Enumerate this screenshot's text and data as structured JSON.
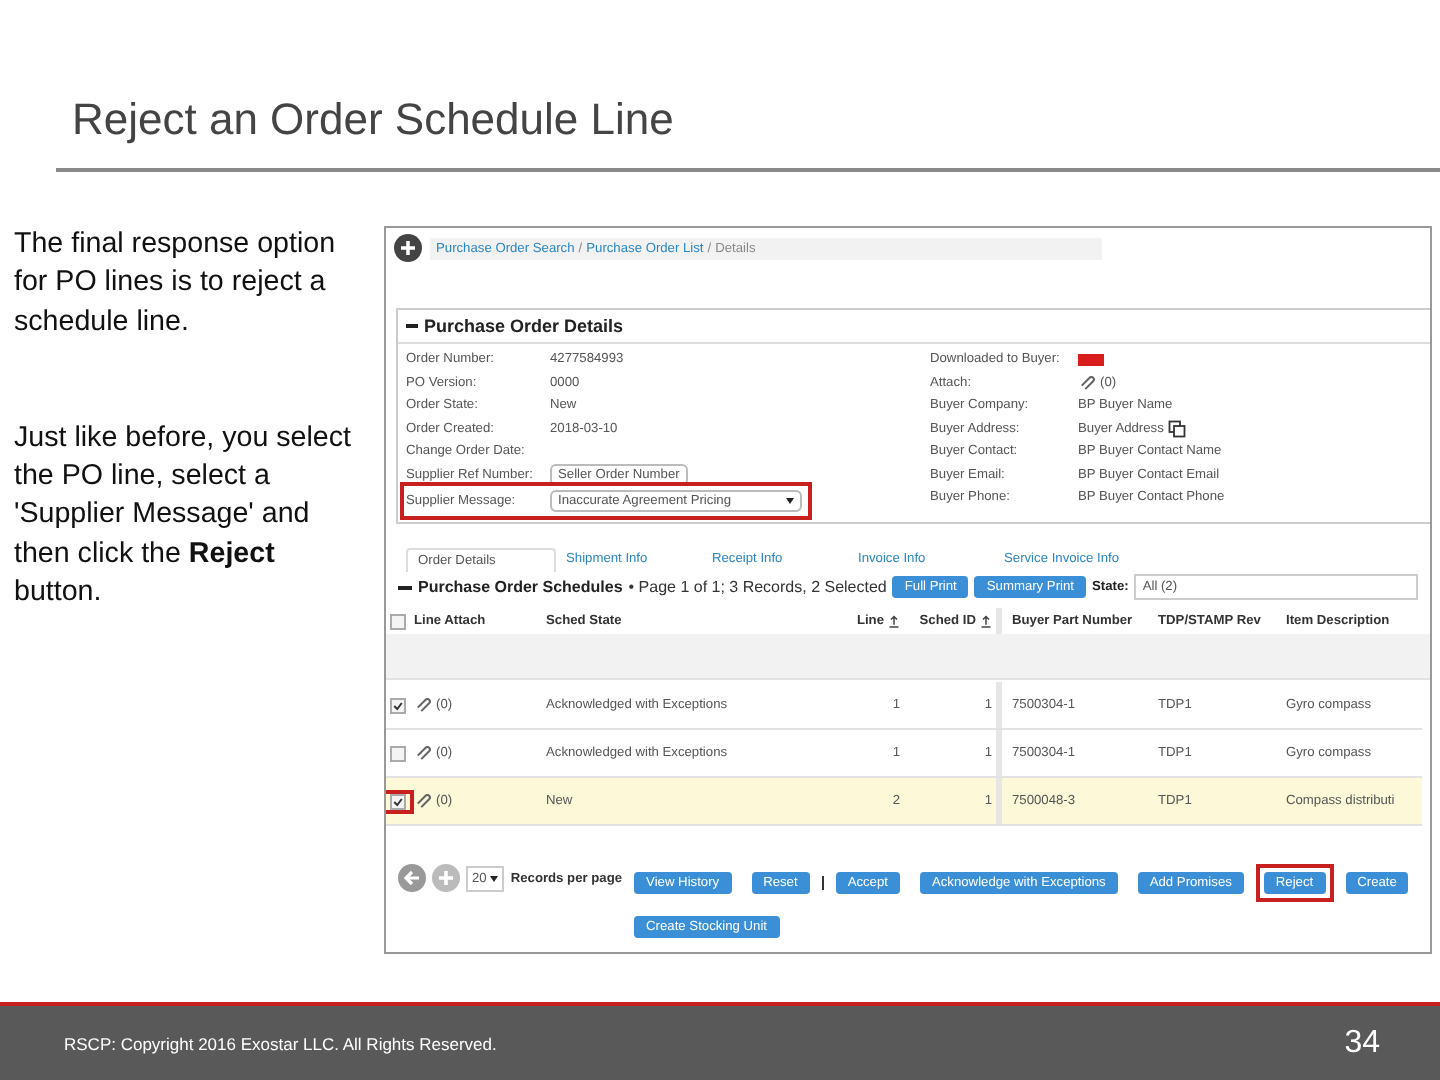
{
  "slide": {
    "title": "Reject an Order Schedule Line",
    "notes": [
      "The final response option for PO lines is to reject a schedule line.",
      "Just like before, you select the PO line, select a 'Supplier Message' and then click the **Reject** button."
    ]
  },
  "screen": {
    "breadcrumb": [
      {
        "label": "Purchase Order Search",
        "kind": "link"
      },
      {
        "label": "Purchase Order List",
        "kind": "link"
      },
      {
        "label": "Details",
        "kind": "current"
      }
    ],
    "breadcrumb_separator": "/",
    "details": {
      "title": "Purchase Order Details",
      "expanded": true,
      "left_fields": [
        {
          "label": "Order Number:",
          "value": "4277584993",
          "kind": "text"
        },
        {
          "label": "PO Version:",
          "value": "0000",
          "kind": "text"
        },
        {
          "label": "Order State:",
          "value": "New",
          "kind": "text"
        },
        {
          "label": "Order Created:",
          "value": "2018-03-10",
          "kind": "text"
        },
        {
          "label": "Change Order Date:",
          "kind": "text"
        },
        {
          "label": "Supplier Ref Number:",
          "value": "Seller Order Number",
          "kind": "input"
        },
        {
          "label": "Supplier Message:",
          "value": "Inaccurate Agreement Pricing",
          "kind": "select",
          "highlighted": true
        }
      ],
      "right_fields": [
        {
          "label": "Downloaded to Buyer:",
          "kind": "flag",
          "color": "#d91c1c"
        },
        {
          "label": "Attach:",
          "value": "(0)",
          "kind": "attach"
        },
        {
          "label": "Buyer Company:",
          "value": "BP Buyer Name",
          "kind": "text"
        },
        {
          "label": "Buyer Address:",
          "value": "Buyer Address",
          "kind": "copy"
        },
        {
          "label": "Buyer Contact:",
          "value": "BP Buyer Contact Name",
          "kind": "text"
        },
        {
          "label": "Buyer Email:",
          "value": "BP Buyer Contact Email",
          "kind": "text"
        },
        {
          "label": "Buyer Phone:",
          "value": "BP Buyer Contact Phone",
          "kind": "text"
        }
      ]
    },
    "tabs": [
      {
        "label": "Order Details",
        "selected": true
      },
      {
        "label": "Shipment Info",
        "selected": false
      },
      {
        "label": "Receipt Info",
        "selected": false
      },
      {
        "label": "Invoice Info",
        "selected": false
      },
      {
        "label": "Service Invoice Info",
        "selected": false
      }
    ],
    "schedules": {
      "title": "Purchase Order Schedules",
      "summary": "• Page 1 of 1; 3 Records, 2 Selected",
      "buttons": [
        "Full Print",
        "Summary Print"
      ],
      "state_label": "State:",
      "state_value": "All (2)",
      "all_checked": false,
      "columns": [
        {
          "label": "Line Attach",
          "sortable": false
        },
        {
          "label": "Sched State",
          "sortable": false
        },
        {
          "label": "Line",
          "sortable": true
        },
        {
          "label": "Sched ID",
          "sortable": true
        },
        {
          "label": "Buyer Part Number",
          "sortable": false
        },
        {
          "label": "TDP/STAMP Rev",
          "sortable": false
        },
        {
          "label": "Item Description",
          "sortable": false
        }
      ],
      "rows": [
        {
          "checked": true,
          "selected": false,
          "highlighted": false,
          "attach": "(0)",
          "state": "Acknowledged with Exceptions",
          "line": "1",
          "sched_id": "1",
          "part": "7500304-1",
          "rev": "TDP1",
          "description": "Gyro compass"
        },
        {
          "checked": false,
          "selected": false,
          "highlighted": false,
          "attach": "(0)",
          "state": "Acknowledged with Exceptions",
          "line": "1",
          "sched_id": "1",
          "part": "7500304-1",
          "rev": "TDP1",
          "description": "Gyro compass"
        },
        {
          "checked": true,
          "selected": true,
          "highlighted": true,
          "attach": "(0)",
          "state": "New",
          "line": "2",
          "sched_id": "1",
          "part": "7500048-3",
          "rev": "TDP1",
          "description": "Compass distributi"
        }
      ],
      "page_size": "20",
      "records_label": "Records per page",
      "actions": [
        {
          "label": "View History",
          "highlighted": false
        },
        {
          "label": "Reset",
          "highlighted": false
        },
        {
          "label": "Accept",
          "highlighted": false
        },
        {
          "label": "Acknowledge with Exceptions",
          "highlighted": false
        },
        {
          "label": "Add Promises",
          "highlighted": false
        },
        {
          "label": "Reject",
          "highlighted": true
        },
        {
          "label": "Create",
          "highlighted": false
        },
        {
          "label": "Create Stocking Unit",
          "highlighted": false
        }
      ]
    }
  },
  "footer": {
    "copyright": "RSCP:  Copyright 2016 Exostar LLC. All Rights Reserved.",
    "page": "34"
  }
}
